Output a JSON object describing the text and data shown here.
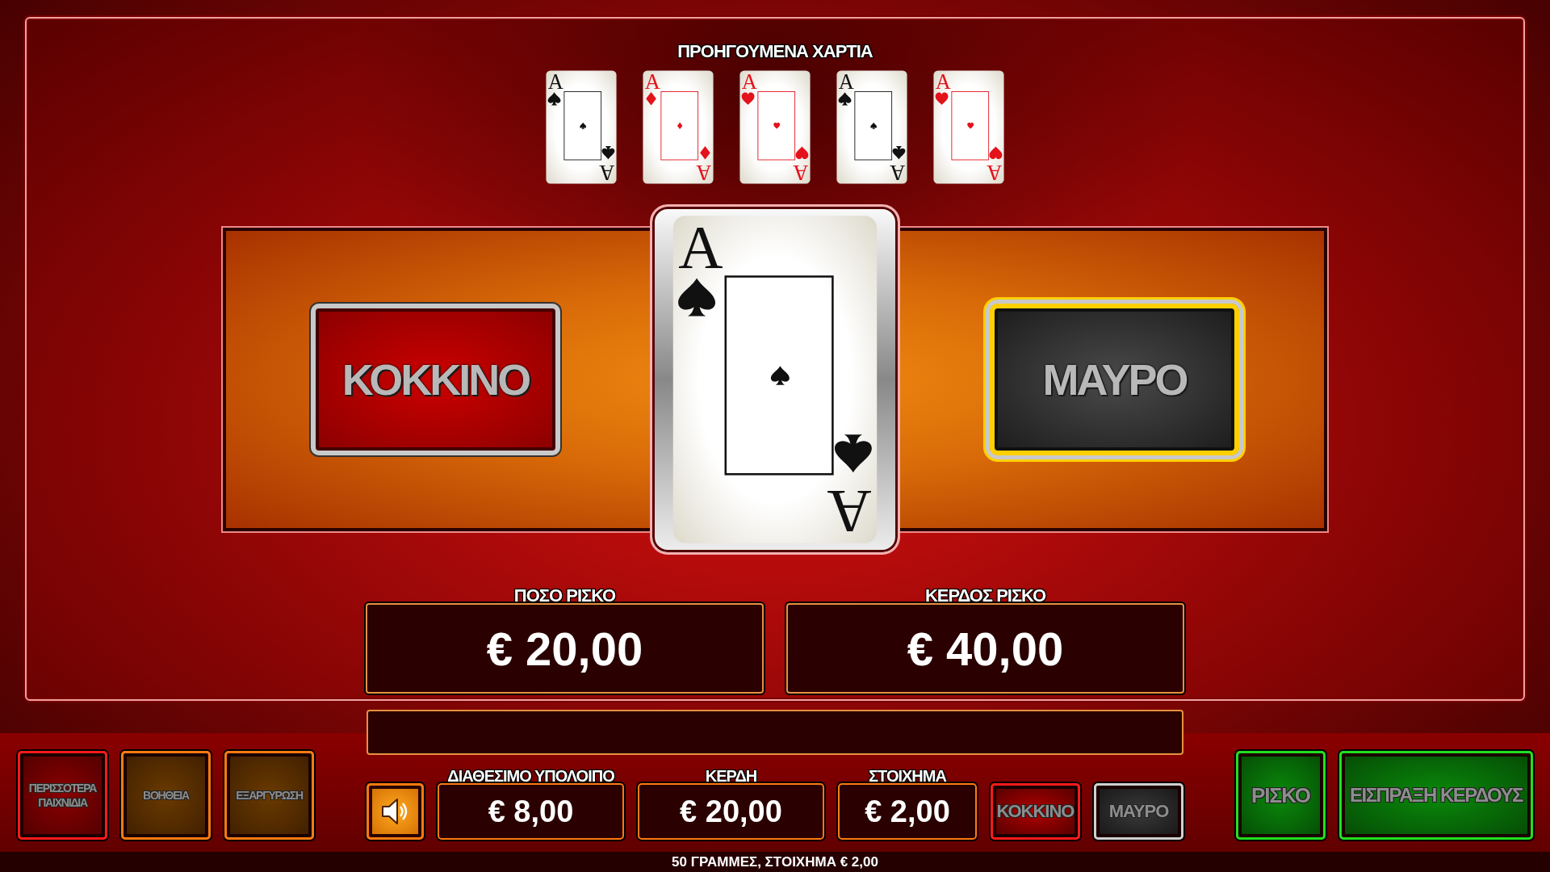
{
  "previous_cards": {
    "title": "ΠΡΟΗΓΟΥΜΕΝΑ ΧΑΡΤΙΑ",
    "cards": [
      {
        "rank": "A",
        "rank_bottom": "A",
        "kind": "spades"
      },
      {
        "rank": "A",
        "rank_bottom": "A",
        "kind": "diamonds"
      },
      {
        "rank": "A",
        "rank_bottom": "A",
        "kind": "hearts"
      },
      {
        "rank": "A",
        "rank_bottom": "A",
        "kind": "spades"
      },
      {
        "rank": "A",
        "rank_bottom": "A",
        "kind": "hearts"
      }
    ]
  },
  "current_card": {
    "rank": "A",
    "rank_bottom": "A",
    "kind": "spades"
  },
  "choices": [
    {
      "label": "ΚΟΚΚΙΝΟ",
      "kind": "red",
      "selected": false
    },
    {
      "label": "ΜΑΥΡΟ",
      "kind": "black",
      "selected": true
    }
  ],
  "risk_meters": [
    {
      "label": "ΠΟΣΟ ΡΙΣΚΟ",
      "value": "€ 20,00"
    },
    {
      "label": "ΚΕΡΔΟΣ ΡΙΣΚΟ",
      "value": "€ 40,00"
    }
  ],
  "left_buttons": [
    {
      "label": "ΠΕΡΙΣΣΟΤΕΡΑ ΠΑΙΧΝΙΔΙΑ",
      "kind": "red"
    },
    {
      "label": "ΒΟΗΘΕΙΑ",
      "kind": "orange"
    },
    {
      "label": "ΕΞΑΡΓΥΡΩΣΗ",
      "kind": "orange"
    }
  ],
  "displays": [
    {
      "label": "ΔΙΑΘΕΣΙΜΟ ΥΠΟΛΟΙΠΟ",
      "value": "€ 8,00",
      "kind": "wide"
    },
    {
      "label": "ΚΕΡΔΗ",
      "value": "€ 20,00",
      "kind": "wide"
    },
    {
      "label": "ΣΤΟΙΧΗΜΑ",
      "value": "€ 2,00",
      "kind": "narrow"
    }
  ],
  "quick_buttons": [
    {
      "label": "ΚΟΚΚΙΝΟ",
      "kind": "red"
    },
    {
      "label": "ΜΑΥΡΟ",
      "kind": "black"
    }
  ],
  "right_buttons": [
    {
      "label": "ΡΙΣΚΟ",
      "kind": "small"
    },
    {
      "label": "ΕΙΣΠΡΑΞΗ ΚΕΡΔΟΥΣ",
      "kind": "large"
    }
  ],
  "status_bar": "50 ΓΡΑΜΜΕΣ, ΣΤΟΙΧΗΜΑ € 2,00"
}
